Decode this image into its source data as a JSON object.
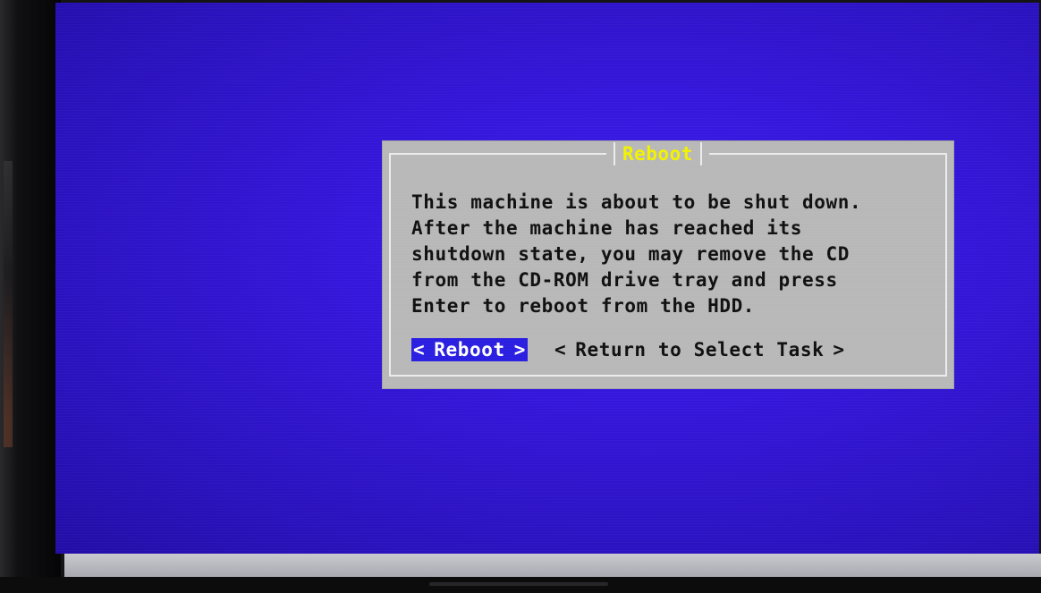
{
  "dialog": {
    "title": "Reboot",
    "message_lines": [
      "This machine is about to be shut down.",
      "After the machine has reached its",
      "shutdown state, you may remove the CD",
      "from the CD-ROM drive tray and press",
      "Enter to reboot from the HDD."
    ],
    "buttons": {
      "reboot": {
        "label": "Reboot",
        "left": "<",
        "right": ">",
        "selected": true
      },
      "return": {
        "label": "Return to Select Task",
        "left": "<",
        "right": ">",
        "selected": false
      }
    }
  },
  "colors": {
    "screen_background": "#3517dc",
    "dialog_background": "#b8b8b8",
    "title_text": "#f2f200",
    "selected_button": "#2a1fe0"
  }
}
